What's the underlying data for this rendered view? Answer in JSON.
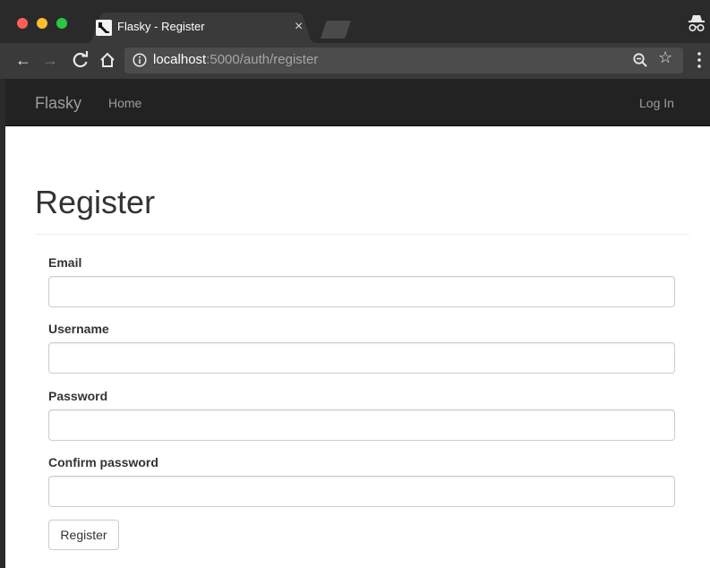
{
  "browser": {
    "tab_title": "Flasky - Register",
    "tab_close": "×",
    "url_host": "localhost",
    "url_rest": ":5000/auth/register",
    "icons": {
      "back": "back-arrow-icon",
      "forward": "forward-arrow-icon",
      "reload": "reload-icon",
      "home": "home-icon",
      "info": "info-icon",
      "zoom": "zoom-out-icon",
      "star": "bookmark-star-icon",
      "menu": "menu-dots-icon",
      "incognito": "incognito-icon"
    }
  },
  "navbar": {
    "brand": "Flasky",
    "home": "Home",
    "login": "Log In",
    "background": "#222222",
    "link_color": "#9d9d9d"
  },
  "page": {
    "title": "Register"
  },
  "form": {
    "email_label": "Email",
    "email_value": "",
    "username_label": "Username",
    "username_value": "",
    "password_label": "Password",
    "password_value": "",
    "confirm_label": "Confirm password",
    "confirm_value": "",
    "submit_label": "Register"
  }
}
